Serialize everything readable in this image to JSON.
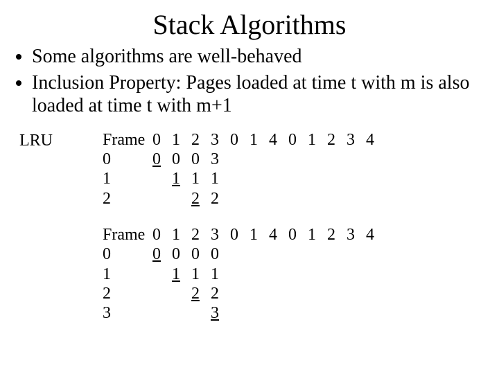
{
  "title": "Stack Algorithms",
  "bullets": [
    "Some algorithms are well-behaved",
    "Inclusion Property: Pages loaded at time t with m is also loaded at time t with m+1"
  ],
  "algo_label": "LRU",
  "tables": [
    {
      "row_labels": [
        "Frame",
        "0",
        "1",
        "2"
      ],
      "cols": 12,
      "cells": [
        [
          "0",
          "1",
          "2",
          "3",
          "0",
          "1",
          "4",
          "0",
          "1",
          "2",
          "3",
          "4"
        ],
        [
          "0",
          "0",
          "0",
          "3",
          "",
          "",
          "",
          "",
          "",
          "",
          "",
          ""
        ],
        [
          "",
          "1",
          "1",
          "1",
          "",
          "",
          "",
          "",
          "",
          "",
          "",
          ""
        ],
        [
          "",
          "",
          "2",
          "2",
          "",
          "",
          "",
          "",
          "",
          "",
          "",
          ""
        ]
      ],
      "underline": [
        [],
        [
          0
        ],
        [
          1
        ],
        [
          2
        ]
      ]
    },
    {
      "row_labels": [
        "Frame",
        "0",
        "1",
        "2",
        "3"
      ],
      "cols": 12,
      "cells": [
        [
          "0",
          "1",
          "2",
          "3",
          "0",
          "1",
          "4",
          "0",
          "1",
          "2",
          "3",
          "4"
        ],
        [
          "0",
          "0",
          "0",
          "0",
          "",
          "",
          "",
          "",
          "",
          "",
          "",
          ""
        ],
        [
          "",
          "1",
          "1",
          "1",
          "",
          "",
          "",
          "",
          "",
          "",
          "",
          ""
        ],
        [
          "",
          "",
          "2",
          "2",
          "",
          "",
          "",
          "",
          "",
          "",
          "",
          ""
        ],
        [
          "",
          "",
          "",
          "3",
          "",
          "",
          "",
          "",
          "",
          "",
          "",
          ""
        ]
      ],
      "underline": [
        [],
        [
          0
        ],
        [
          1
        ],
        [
          2
        ],
        [
          3
        ]
      ]
    }
  ]
}
